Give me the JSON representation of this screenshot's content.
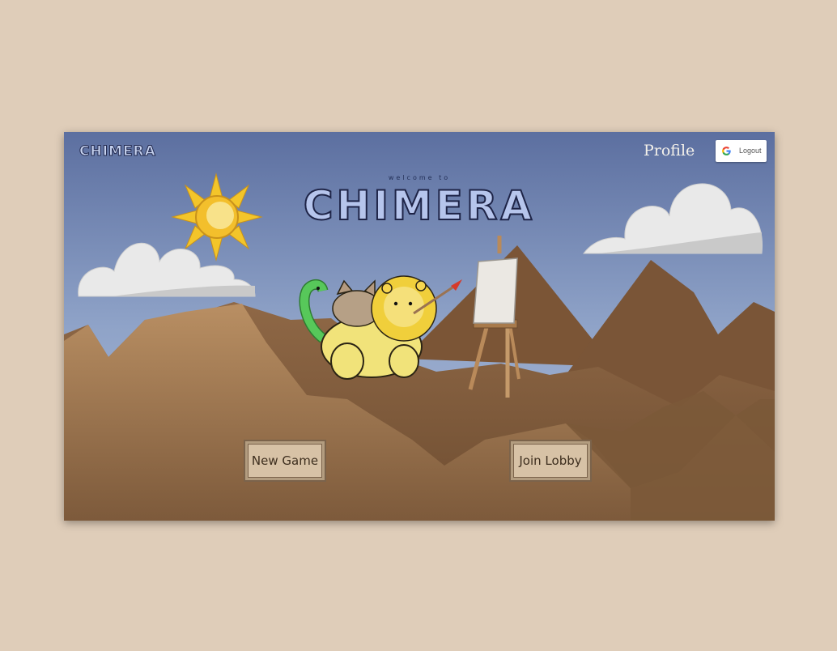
{
  "header": {
    "logo_text": "CHIMERA",
    "profile_label": "Profile",
    "logout_label": "Logout"
  },
  "hero": {
    "welcome_text": "welcome to",
    "title": "CHIMERA"
  },
  "menu": {
    "new_game_label": "New Game",
    "join_lobby_label": "Join Lobby"
  },
  "colors": {
    "page_background": "#dfcdb9",
    "sky_top": "#5b6fa0",
    "mountain": "#8a6646",
    "button_fill": "#d7c2a6"
  }
}
